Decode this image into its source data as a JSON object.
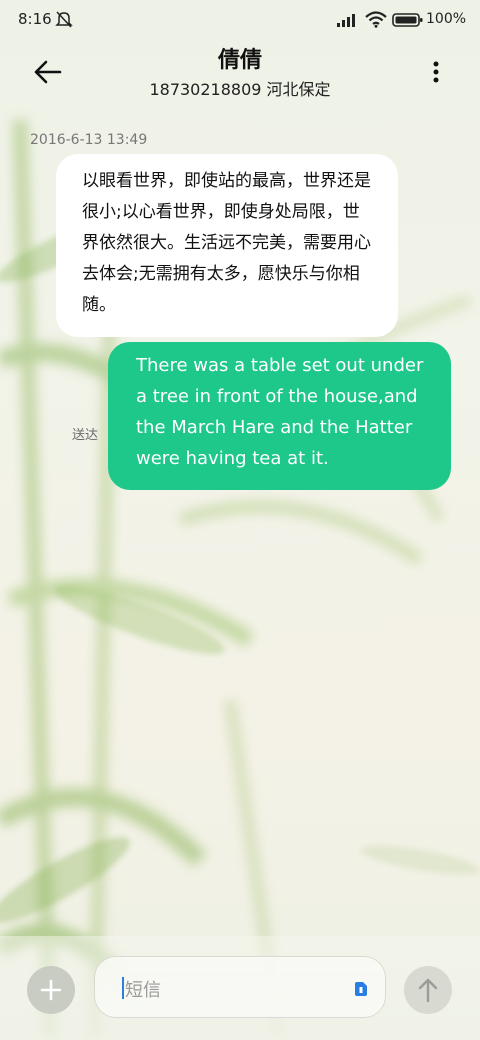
{
  "status_bar": {
    "time": "8:16",
    "battery_text": "100%",
    "icons": [
      "bell-muted-icon",
      "signal-icon",
      "wifi-icon",
      "battery-icon"
    ]
  },
  "header": {
    "back_icon": "arrow-left-icon",
    "contact_name": "倩倩",
    "contact_subtitle": "18730218809 河北保定",
    "menu_icon": "more-vertical-icon"
  },
  "conversation": {
    "timestamp": "2016-6-13 13:49",
    "incoming_message": "以眼看世界，即使站的最高，世界还是很小;以心看世界，即使身处局限，世界依然很大。生活远不完美，需要用心去体会;无需拥有太多，愿快乐与你相随。",
    "outgoing_message": "There was a table set out under a tree in front of the house,and the March Hare and the Hatter were having tea at it.",
    "outgoing_status": "送达"
  },
  "input_bar": {
    "placeholder": "短信",
    "add_icon": "plus-icon",
    "sim_icon": "sim-card-icon",
    "send_icon": "arrow-up-icon"
  },
  "colors": {
    "outgoing_bubble": "#1ec88b",
    "incoming_bubble": "#ffffff",
    "accent": "#2a7de1"
  }
}
